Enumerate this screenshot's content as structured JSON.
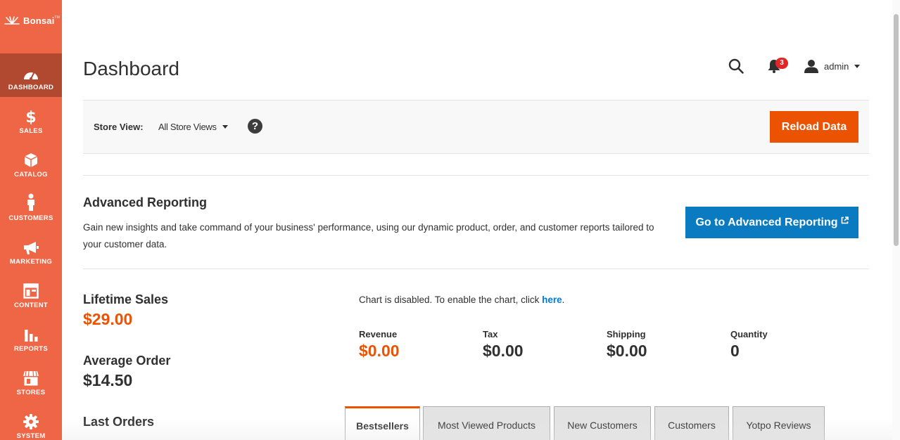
{
  "brand": {
    "name": "Bonsai",
    "tm": "TM"
  },
  "sidebar": {
    "items": [
      {
        "label": "Dashboard",
        "icon": "dashboard-icon",
        "active": true
      },
      {
        "label": "Sales",
        "icon": "dollar-icon"
      },
      {
        "label": "Catalog",
        "icon": "box-icon"
      },
      {
        "label": "Customers",
        "icon": "person-icon"
      },
      {
        "label": "Marketing",
        "icon": "megaphone-icon"
      },
      {
        "label": "Content",
        "icon": "layout-icon"
      },
      {
        "label": "Reports",
        "icon": "bar-chart-icon"
      },
      {
        "label": "Stores",
        "icon": "storefront-icon"
      },
      {
        "label": "System",
        "icon": "gear-icon"
      }
    ]
  },
  "header": {
    "title": "Dashboard",
    "notifications_count": "3",
    "user": "admin"
  },
  "store_view": {
    "label": "Store View:",
    "selected": "All Store Views",
    "help": "?",
    "reload_label": "Reload Data"
  },
  "advanced_reporting": {
    "title": "Advanced Reporting",
    "description": "Gain new insights and take command of your business' performance, using our dynamic product, order, and customer reports tailored to your customer data.",
    "button_label": "Go to Advanced Reporting"
  },
  "stats": {
    "lifetime_sales_label": "Lifetime Sales",
    "lifetime_sales_value": "$29.00",
    "average_order_label": "Average Order",
    "average_order_value": "$14.50",
    "last_orders_label": "Last Orders"
  },
  "chart_note": {
    "text": "Chart is disabled. To enable the chart, click ",
    "link": "here",
    "suffix": "."
  },
  "totals": [
    {
      "label": "Revenue",
      "value": "$0.00"
    },
    {
      "label": "Tax",
      "value": "$0.00"
    },
    {
      "label": "Shipping",
      "value": "$0.00"
    },
    {
      "label": "Quantity",
      "value": "0"
    }
  ],
  "tabs": [
    {
      "label": "Bestsellers",
      "active": true
    },
    {
      "label": "Most Viewed Products"
    },
    {
      "label": "New Customers"
    },
    {
      "label": "Customers"
    },
    {
      "label": "Yotpo Reviews"
    }
  ],
  "colors": {
    "sidebar": "#ee6645",
    "sidebar_active": "#b14830",
    "accent_orange": "#eb5202",
    "link_blue": "#007bdb",
    "button_blue": "#0a7bc1"
  }
}
